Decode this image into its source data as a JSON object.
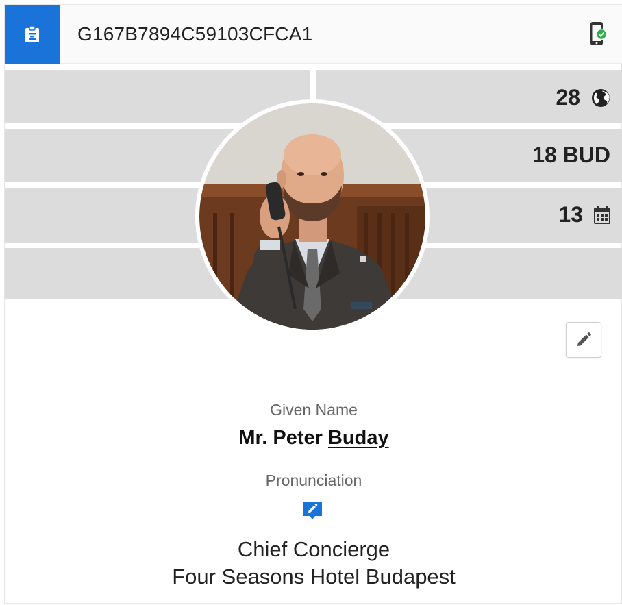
{
  "header": {
    "profile_id": "G167B7894C59103CFCA1",
    "badge_icon": "badge-icon",
    "device_icon": "mobile-verified-icon"
  },
  "stats": [
    {
      "value": "28",
      "icon": "globe-icon"
    },
    {
      "value": "18 BUD",
      "icon": ""
    },
    {
      "value": "13",
      "icon": "calendar-icon"
    }
  ],
  "profile": {
    "given_name_label": "Given Name",
    "salutation": "Mr.",
    "first_name": "Peter",
    "last_name": "Buday",
    "pronunciation_label": "Pronunciation",
    "job_title": "Chief Concierge",
    "company": "Four Seasons Hotel Budapest"
  },
  "colors": {
    "accent": "#1a73d9",
    "verified": "#2bb04a",
    "row_grey": "#dcdcdc"
  }
}
